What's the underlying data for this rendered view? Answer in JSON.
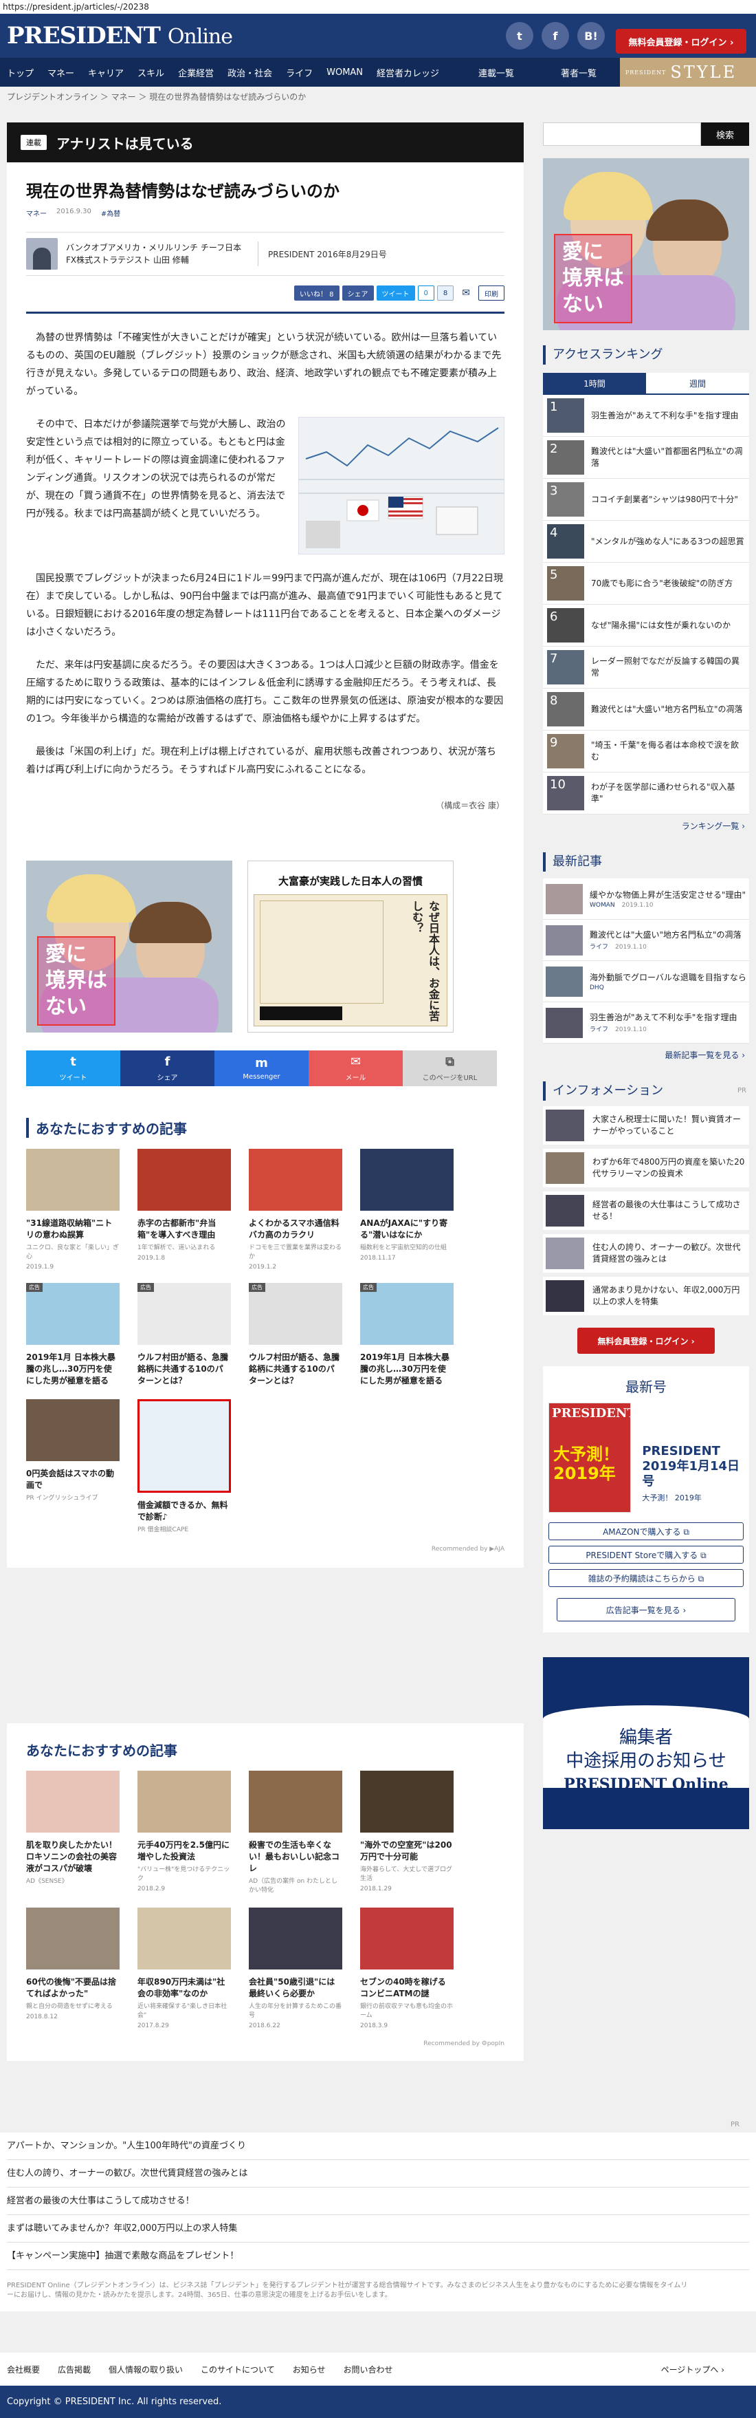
{
  "url": "https://president.jp/articles/-/20238",
  "header": {
    "logo": "PRESIDENT",
    "logo_online": "Online",
    "login": "無料会員登録・ログイン ›",
    "twitter": "t",
    "facebook": "f",
    "hatena": "B!"
  },
  "nav": {
    "items": [
      "トップ",
      "マネー",
      "キャリア",
      "スキル",
      "企業経営",
      "政治・社会",
      "ライフ",
      "WOMAN",
      "経営者カレッジ"
    ],
    "rensai": "連載一覧",
    "chosha": "著者一覧",
    "style": "STYLE",
    "style_small": "PRESIDENT"
  },
  "breadcrumb": "プレジデントオンライン ＞ マネー ＞ 現在の世界為替情勢はなぜ読みづらいのか",
  "banner": {
    "tag": "連載",
    "title": "アナリストは見ている"
  },
  "article": {
    "title": "現在の世界為替情勢はなぜ読みづらいのか",
    "category": "マネー",
    "date": "2016.9.30",
    "hashtag": "#為替",
    "author": "バンクオブアメリカ・メリルリンチ チーフ日本FX株式ストラテジスト 山田 修輔",
    "pubdate": "PRESIDENT 2016年8月29日号",
    "shares": {
      "like": "いいね！ 8",
      "share": "シェア",
      "tweet": "ツイート",
      "hatena": "0",
      "pocket": "8",
      "print": "印刷"
    },
    "p1": "為替の世界情勢は「不確実性が大きいことだけが確実」という状況が続いている。欧州は一旦落ち着いているものの、英国のEU離脱（ブレグジット）投票のショックが懸念され、米国も大統領選の結果がわかるまで先行きが見えない。多発しているテロの問題もあり、政治、経済、地政学いずれの観点でも不確定要素が積み上がっている。",
    "p2": "その中で、日本だけが参議院選挙で与党が大勝し、政治の安定性という点では相対的に際立っている。もともと円は金利が低く、キャリートレードの際は資金調達に使われるファンディング通貨。リスクオンの状況では売られるのが常だが、現在の「買う通貨不在」の世界情勢を見ると、消去法で円が残る。秋までは円高基調が続くと見ていいだろう。",
    "p3": "国民投票でブレグジットが決まった6月24日に1ドル＝99円まで円高が進んだが、現在は106円（7月22日現在）まで戻している。しかし私は、90円台中盤までは円高が進み、最高値で91円までいく可能性もあると見ている。日銀短観における2016年度の想定為替レートは111円台であることを考えると、日本企業へのダメージは小さくないだろう。",
    "p4": "ただ、来年は円安基調に戻るだろう。その要因は大きく3つある。1つは人口減少と巨額の財政赤字。借金を圧縮するために取りうる政策は、基本的にはインフレ＆低金利に誘導する金融抑圧だろう。そう考えれば、長期的には円安になっていく。2つめは原油価格の底打ち。ここ数年の世界景気の低迷は、原油安が根本的な要因の1つ。今年後半から構造的な需給が改善するはずで、原油価格も緩やかに上昇するはずだ。",
    "p5": "最後は「米国の利上げ」だ。現在利上げは棚上げされているが、雇用状態も改善されつつあり、状況が落ち着けば再び利上げに向かうだろう。そうすればドル高円安にふれることになる。",
    "credit": "（構成＝衣谷 康）"
  },
  "ads": {
    "kids_text": "愛に\n境界は\nない",
    "book_title": "大富豪が実践した日本人の習慣",
    "book_text": "なぜ日本人は、お金に苦しむ？"
  },
  "sharebar": [
    {
      "icon": "t",
      "label": "ツイート",
      "color": "#1d9bf0"
    },
    {
      "icon": "f",
      "label": "シェア",
      "color": "#1d3f8a"
    },
    {
      "icon": "m",
      "label": "Messenger",
      "color": "#2d6ee0"
    },
    {
      "icon": "✉",
      "label": "メール",
      "color": "#e85a5a"
    },
    {
      "icon": "⧉",
      "label": "このページをURL",
      "color": "#d8d8d8"
    }
  ],
  "rec1": {
    "title": "あなたにおすすめの記事",
    "cards": [
      {
        "t": "\"31線道路収納箱\"ニトリの意わぬ誤算",
        "s": "ユニクロ、良な家と「楽しい」ぎ心",
        "d": "2019.1.9",
        "c": "#c9b99a",
        "ad": ""
      },
      {
        "t": "赤字の古都新市\"弁当箱\"を導入すべき理由",
        "s": "1年で解析で、道い込まれる",
        "d": "2019.1.8",
        "c": "#b43a2a",
        "ad": ""
      },
      {
        "t": "よくわかるスマホ通信料バカ高のカラクリ",
        "s": "ドコモを三で置業を業界は変わるか",
        "d": "2019.1.2",
        "c": "#d44a3a",
        "ad": ""
      },
      {
        "t": "ANAがJAXAに\"すり寄る\"潜いはなにか",
        "s": "稲数利をと宇宙航空知的の仕組",
        "d": "2018.11.17",
        "c": "#2a3a5e",
        "ad": ""
      },
      {
        "t": "2019年1月 日本株大暴騰の兆し…30万円を使にした男が極意を語る",
        "s": "",
        "d": "",
        "c": "#9ecbe4",
        "ad": "広告"
      },
      {
        "t": "ウルフ村田が語る、急騰銘柄に共通する10のパターンとは？",
        "s": "",
        "d": "",
        "c": "#eaeaea",
        "ad": "広告"
      },
      {
        "t": "ウルフ村田が語る、急騰銘柄に共通する10のパターンとは？",
        "s": "",
        "d": "",
        "c": "#e0e0e0",
        "ad": "広告"
      },
      {
        "t": "2019年1月 日本株大暴騰の兆し…30万円を使にした男が極意を語る",
        "s": "",
        "d": "",
        "c": "#9ecbe4",
        "ad": "広告"
      },
      {
        "t": "0円英会話はスマホの動画で",
        "s": "PR イングリッシュライブ",
        "d": "",
        "c": "#6f5a4a",
        "ad": ""
      },
      {
        "t": "借金減額できるか、無料で診断♪",
        "s": "PR 借金相談CAPE",
        "d": "",
        "c": "#e8f0f8",
        "ad": ""
      }
    ],
    "recby": "Recommended by ▶AJA"
  },
  "rec2": {
    "title": "あなたにおすすめの記事",
    "cards": [
      {
        "t": "肌を取り戻したかたい！ロキソニンの会社の美容液がコスパが破壊",
        "s": "AD《SENSE》",
        "d": "",
        "c": "#e7c3b8"
      },
      {
        "t": "元手40万円を2.5億円に増やした投資法",
        "s": "\"バリュー株\"を見つけるテクニック",
        "d": "2018.2.9",
        "c": "#c8b090"
      },
      {
        "t": "殺害での生活も辛くない！最もおいしい記念コレ",
        "s": "AD（広告の案件 on わたしとしかい特化",
        "d": "",
        "c": "#8a6a4a"
      },
      {
        "t": "\"海外での空室死\"は200万円で十分可能",
        "s": "海外暮らして、大丈しで選ブログ生活",
        "d": "2018.1.29",
        "c": "#4a3a2a"
      },
      {
        "t": "60代の後悔\"不要品は捨てればよかった\"",
        "s": "親と自分の荷造をせずに考える",
        "d": "2018.8.12",
        "c": "#9a8a7a"
      },
      {
        "t": "年収890万円未満は\"社会の非効率\"なのか",
        "s": "近い将来確保する\"楽しき日本社会\"",
        "d": "2017.8.29",
        "c": "#d4c4a8"
      },
      {
        "t": "会社員\"50歳引退\"には最終いくら必要か",
        "s": "人生の年分を計算するためこの番号",
        "d": "2018.6.22",
        "c": "#3a3a4a"
      },
      {
        "t": "セブンの40時を稼げるコンビニATMの謎",
        "s": "銀行の前収収テマも意も均金のホーム",
        "d": "2018.3.9",
        "c": "#c23a3a"
      }
    ],
    "recby": "Recommended by ⚙popIn"
  },
  "side": {
    "search": "検索",
    "ranking_title": "アクセスランキング",
    "tab1": "1時間",
    "tab2": "週間",
    "ranking": [
      {
        "n": "1",
        "t": "羽生善治が\"あえて不利な手\"を指す理由",
        "c": "#505a6e"
      },
      {
        "n": "2",
        "t": "難波代とは\"大盛い\"首都圏名門私立\"の凋落",
        "c": "#6b6b6b"
      },
      {
        "n": "3",
        "t": "ココイチ創業者\"シャツは980円で十分\"",
        "c": "#7a7a7a"
      },
      {
        "n": "4",
        "t": "\"メンタルが強めな人\"にある3つの超思賞",
        "c": "#3a4a5a"
      },
      {
        "n": "5",
        "t": "70歳でも彫に合う\"老後破綻\"の防ぎ方",
        "c": "#7a6a5a"
      },
      {
        "n": "6",
        "t": "なぜ\"陽永揚\"には女性が乗れないのか",
        "c": "#4a4a4a"
      },
      {
        "n": "7",
        "t": "レーダー照射でなだが反論する韓国の異常",
        "c": "#5a6a7a"
      },
      {
        "n": "8",
        "t": "難波代とは\"大盛い\"地方名門私立\"の凋落",
        "c": "#6b6b6b"
      },
      {
        "n": "9",
        "t": "\"埼玉・千葉\"を侮る者は本命校で涙を飲む",
        "c": "#8a7a6a"
      },
      {
        "n": "10",
        "t": "わが子を医学部に通わせられる\"収入基準\"",
        "c": "#5a5a6a"
      }
    ],
    "ranking_more": "ランキング一覧 ›",
    "new_title": "最新記事",
    "news": [
      {
        "t": "緩やかな物価上昇が生活安定させる\"理由\"",
        "cat": "WOMAN",
        "d": "2019.1.10",
        "c": "#a99"
      },
      {
        "t": "難波代とは\"大盛い\"地方名門私立\"の凋落",
        "cat": "ライフ",
        "d": "2019.1.10",
        "c": "#889"
      },
      {
        "t": "海外動脈でグローバルな退職を目指すなら",
        "cat": "DHQ",
        "d": "",
        "c": "#6a7a8a"
      },
      {
        "t": "羽生善治が\"あえて不利な手\"を指す理由",
        "cat": "ライフ",
        "d": "2019.1.10",
        "c": "#556"
      }
    ],
    "new_more": "最新記事一覧を見る ›",
    "info_title": "インフォメーション",
    "info_pr": "PR",
    "infos": [
      {
        "t": "大家さん税理士に聞いた！賢い資賃オーナーがやっていること",
        "c": "#556"
      },
      {
        "t": "わずか6年で4800万円の資産を築いた20代サラリーマンの投資术",
        "c": "#8a7a6a"
      },
      {
        "t": "経営者の最後の大仕事はこうして成功させる！",
        "c": "#445"
      },
      {
        "t": "住む人の誇り、オーナーの歓び。次世代賃貸経営の強みとは",
        "c": "#99a"
      },
      {
        "t": "通常あまり見かけない、年収2,000万円以上の求人を特集",
        "c": "#334"
      }
    ],
    "login": "無料会員登録・ログイン ›",
    "latest_title": "最新号",
    "mag_name": "PRESIDENT\n2019年1月14日号",
    "mag_sub": "大予測！ 2019年",
    "cover_logo": "PRESIDENT",
    "cover_text": "大予測！\n2019年",
    "buy1": "AMAZONで購入する ⧉",
    "buy2": "PRESIDENT Storeで購入する ⧉",
    "buy3": "雑誌の予約購読はこちらから ⧉",
    "adlist": "広告記事一覧を見る ›",
    "hire1": "編集者",
    "hire2": "中途採用のお知らせ",
    "hire3": "PRESIDENT Online"
  },
  "footer": {
    "pr": "PR",
    "links": [
      "アパートか、マンションか。\"人生100年時代\"の資産づくり",
      "住む人の誇り、オーナーの歓び。次世代賃貸経営の強みとは",
      "経営者の最後の大仕事はこうして成功させる！",
      "まずは聴いてみませんか？年収2,000万円以上の求人特集",
      "【キャンペーン実施中】抽選で素敵な商品をプレゼント！"
    ],
    "about": "PRESIDENT Online（プレジデントオンライン）は、ビジネス誌「プレジデント」を発行するプレジデント社が運営する総合情報サイトです。みなさまのビジネス人生をより豊かなものにするために必要な情報をタイムリーにお届けし、情報の見かた・読みかたを提示します。24時間、365日、仕事の意思決定の確度を上げるお手伝いをします。",
    "nav": [
      "会社概要",
      "広告掲載",
      "個人情報の取り扱い",
      "このサイトについて",
      "お知らせ",
      "お問い合わせ"
    ],
    "pagetop": "ページトップへ ›",
    "copyright": "Copyright © PRESIDENT Inc. All rights reserved."
  }
}
